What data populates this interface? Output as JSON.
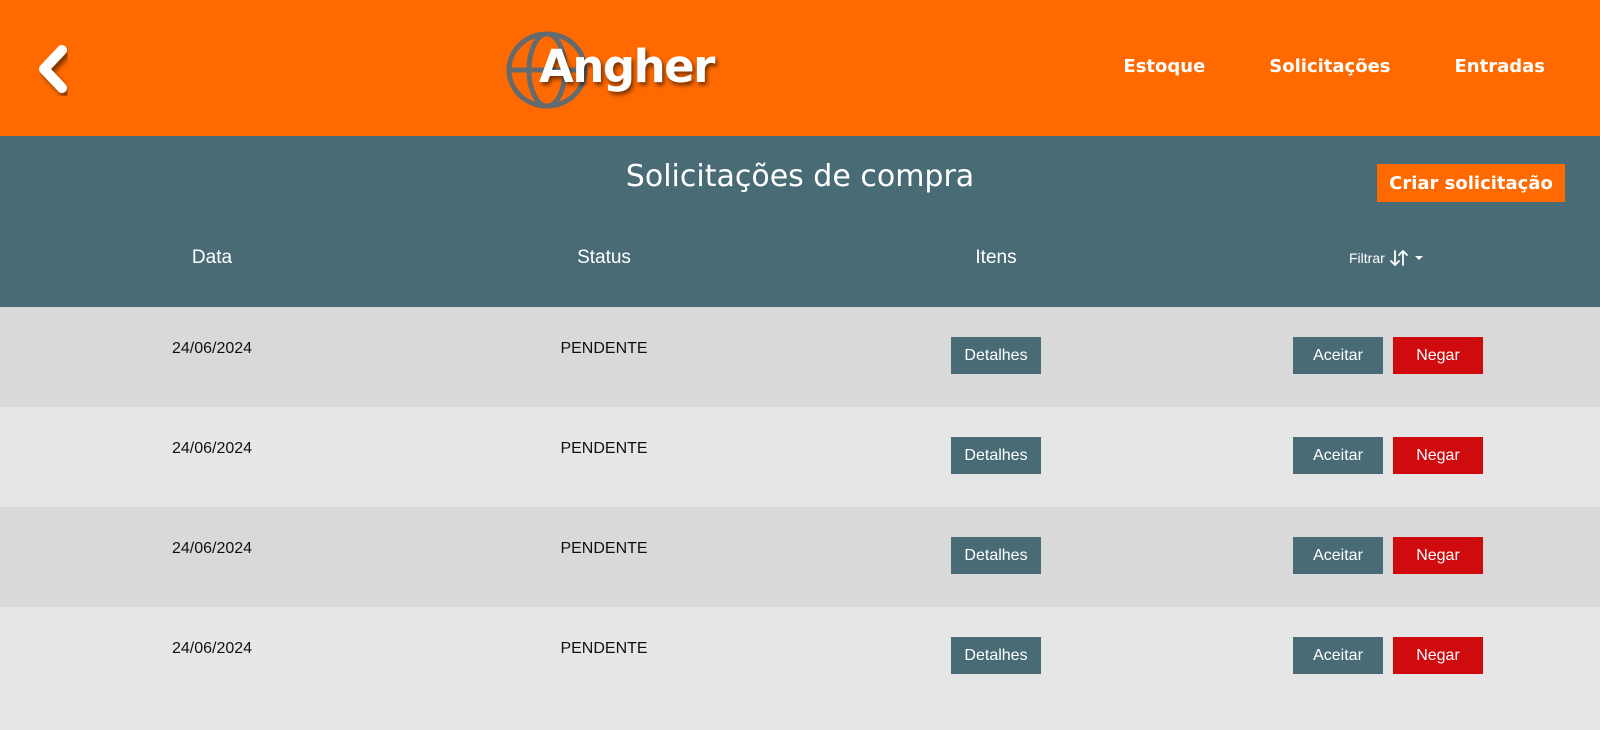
{
  "navbar": {
    "back_icon": "chevron-left-icon",
    "logo_text": "Angher",
    "links": [
      {
        "label": "Estoque"
      },
      {
        "label": "Solicitações"
      },
      {
        "label": "Entradas"
      }
    ]
  },
  "page": {
    "title": "Solicitações de compra",
    "create_button": "Criar solicitação"
  },
  "table": {
    "columns": [
      "Data",
      "Status",
      "Itens"
    ],
    "filter_label": "Filtrar",
    "rows": [
      {
        "date": "24/06/2024",
        "status": "PENDENTE",
        "details": "Detalhes",
        "accept": "Aceitar",
        "deny": "Negar"
      },
      {
        "date": "24/06/2024",
        "status": "PENDENTE",
        "details": "Detalhes",
        "accept": "Aceitar",
        "deny": "Negar"
      },
      {
        "date": "24/06/2024",
        "status": "PENDENTE",
        "details": "Detalhes",
        "accept": "Aceitar",
        "deny": "Negar"
      },
      {
        "date": "24/06/2024",
        "status": "PENDENTE",
        "details": "Detalhes",
        "accept": "Aceitar",
        "deny": "Negar"
      }
    ]
  },
  "colors": {
    "primary_orange": "#ff6a00",
    "header_teal": "#496b75",
    "deny_red": "#d00b0d",
    "row_dark": "#d9d9d9",
    "row_light": "#e6e6e6"
  }
}
